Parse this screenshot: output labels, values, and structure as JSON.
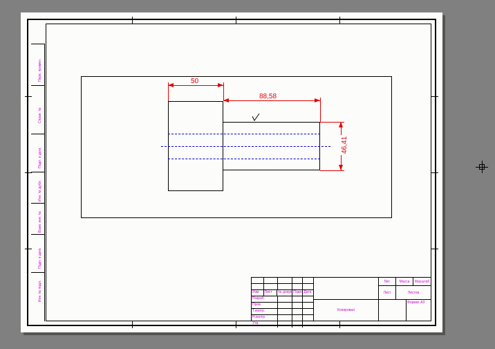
{
  "dimensions": {
    "d1": "50",
    "d2": "88,58",
    "d3": "46,41"
  },
  "side_labels": {
    "s1": "Перв. примен.",
    "s2": "Справ. №",
    "s3": "Подп. и дата",
    "s4": "Инв. № дубл.",
    "s5": "Взам. инв. №",
    "s6": "Подп. и дата",
    "s7": "Инв. № подл."
  },
  "title_block": {
    "izm": "Изм",
    "list": "Лист",
    "ndoc": "№ докум.",
    "podp": "Подп.",
    "data": "Дата",
    "razrab": "Разраб.",
    "prov": "Пров.",
    "tcontr": "Т.контр.",
    "ncontr": "Н.контр.",
    "utv": "Утв.",
    "lit": "Лит.",
    "massa": "Масса",
    "mashtab": "Масштаб",
    "list2": "Лист",
    "listov": "Листов",
    "kopiroval": "Копировал",
    "format": "Формат А3"
  }
}
